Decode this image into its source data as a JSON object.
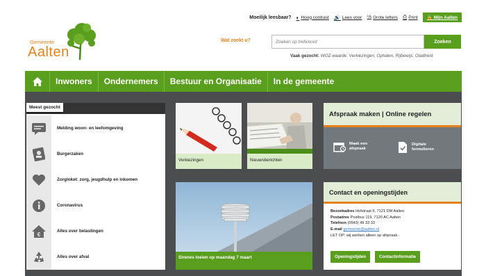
{
  "utility": {
    "title": "Moeilijk leesbaar?",
    "hoog_contrast": "Hoog contrast",
    "lees_voor": "Lees voor",
    "grote_letters": "Grote letters",
    "print": "Print",
    "mijn_aalten": "Mijn Aalten",
    "icons": [
      "contrast-icon",
      "speaker-icon",
      "text-size-icon",
      "printer-icon",
      "lock-icon"
    ]
  },
  "logo": {
    "gemeente": "Gemeente",
    "name": "Aalten"
  },
  "search": {
    "label": "Wat zoekt u?",
    "placeholder": "Zoeken op trefwoord",
    "button": "Zoeken",
    "vaak_label": "Vaak gezocht:",
    "vaak_terms": "WOZ-waarde, Verkiezingen, Ophalen, Rijbewijs, Gladheid"
  },
  "nav": {
    "home_icon": "home-icon",
    "items": [
      "Inwoners",
      "Ondernemers",
      "Bestuur en Organisatie",
      "In de gemeente"
    ]
  },
  "meest": {
    "tab": "Meest gezocht",
    "items": [
      {
        "label": "Melding woon- en leefomgeving",
        "icon": "chat-icon"
      },
      {
        "label": "Burgerzaken",
        "icon": "id-card-icon"
      },
      {
        "label": "Zorgloket: zorg, jeugdhulp en inkomen",
        "icon": "heart-icon"
      },
      {
        "label": "Coronavirus",
        "icon": "info-icon"
      },
      {
        "label": "Alles over belastingen",
        "icon": "house-euro-icon"
      },
      {
        "label": "Alles over afval",
        "icon": "recycle-icon"
      }
    ]
  },
  "tiles": {
    "t1": "Verkiezingen",
    "t2": "Nieuwsberichten",
    "t3": "Sirenes loeien op maandag 7 maart"
  },
  "afspraak": {
    "title": "Afspraak maken | Online regelen",
    "opt1": [
      "Maak een",
      "afspraak"
    ],
    "opt2": [
      "Digitale",
      "formulieren"
    ]
  },
  "contact": {
    "title": "Contact en openingstijden",
    "bezoekadres_label": "Bezoekadres",
    "bezoekadres": "Hofstraat 6, 7121 DM Aalten",
    "postadres_label": "Postadres",
    "postadres": "Postbus 119, 7120 AC Aalten",
    "telefoon_label": "Telefoon",
    "telefoon": "(0543) 49 33 33",
    "email_label": "E-mail",
    "email": "gemeente@aalten.nl",
    "let_op": "LET OP: wij werken alleen op afspraak.",
    "btn1": "Openingstijden",
    "btn2": "Contactinformatie"
  },
  "colors": {
    "green": "#5a9e1e",
    "orange": "#e8801a",
    "dark": "#4b4d4f",
    "light_green": "#d9ecc7"
  }
}
